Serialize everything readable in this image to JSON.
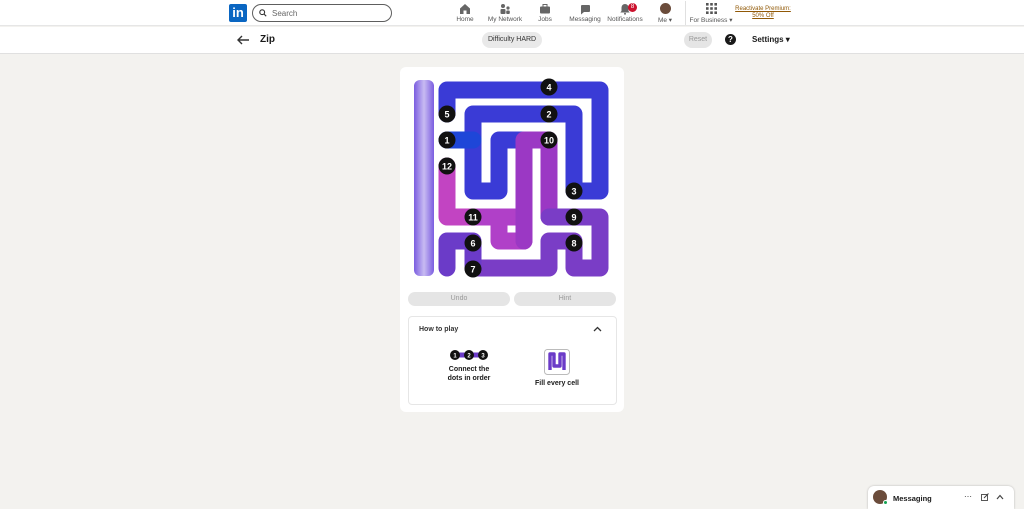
{
  "nav": {
    "search_placeholder": "Search",
    "items": [
      {
        "label": "Home",
        "icon": "home-icon"
      },
      {
        "label": "My Network",
        "icon": "network-icon"
      },
      {
        "label": "Jobs",
        "icon": "jobs-icon"
      },
      {
        "label": "Messaging",
        "icon": "messaging-icon"
      },
      {
        "label": "Notifications",
        "icon": "bell-icon",
        "badge": "8"
      },
      {
        "label": "Me",
        "icon": "avatar"
      },
      {
        "label": "For Business",
        "icon": "grid-icon"
      }
    ],
    "premium_text": "Reactivate Premium: 50% Off",
    "accent": "#0a66c2"
  },
  "game": {
    "title": "Zip",
    "difficulty": "Difficulty HARD",
    "reset_label": "Reset",
    "help_label": "?",
    "settings_label": "Settings",
    "undo_label": "Undo",
    "hint_label": "Hint",
    "grid_size": 7,
    "numbers": [
      {
        "n": "1",
        "row": 2,
        "col": 1
      },
      {
        "n": "2",
        "row": 1,
        "col": 5
      },
      {
        "n": "3",
        "row": 4,
        "col": 6
      },
      {
        "n": "4",
        "row": 0,
        "col": 5
      },
      {
        "n": "5",
        "row": 1,
        "col": 1
      },
      {
        "n": "6",
        "row": 6,
        "col": 2
      },
      {
        "n": "7",
        "row": 7,
        "col": 2
      },
      {
        "n": "8",
        "row": 6,
        "col": 6
      },
      {
        "n": "9",
        "row": 5,
        "col": 6
      },
      {
        "n": "10",
        "row": 2,
        "col": 5
      },
      {
        "n": "11",
        "row": 5,
        "col": 2
      },
      {
        "n": "12",
        "row": 3,
        "col": 1
      }
    ]
  },
  "how_to_play": {
    "title": "How to play",
    "step1_caption": "Connect the dots in order",
    "step1_dots": [
      "1",
      "2",
      "3"
    ],
    "step2_caption": "Fill every cell"
  },
  "messaging": {
    "label": "Messaging"
  }
}
